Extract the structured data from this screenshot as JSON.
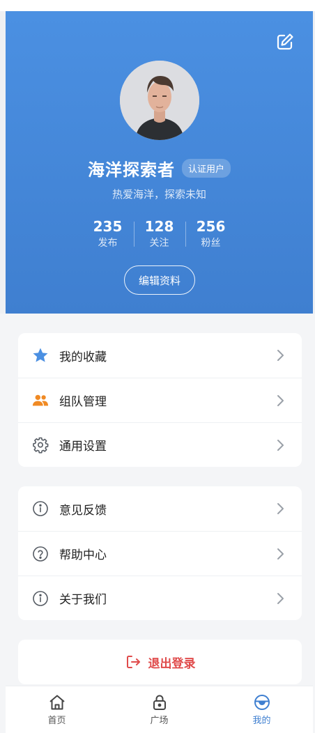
{
  "colors": {
    "accent": "#4b90e2",
    "logout": "#e04b4b",
    "team_icon": "#f08a24"
  },
  "profile": {
    "name": "海洋探索者",
    "badge": "认证用户",
    "bio": "热爱海洋，探索未知",
    "edit_button": "编辑资料",
    "edit_icon": "edit-icon",
    "stats": [
      {
        "value": "235",
        "label": "发布"
      },
      {
        "value": "128",
        "label": "关注"
      },
      {
        "value": "256",
        "label": "粉丝"
      }
    ]
  },
  "menu_group_1": [
    {
      "label": "我的收藏",
      "icon": "star-icon"
    },
    {
      "label": "组队管理",
      "icon": "team-icon"
    },
    {
      "label": "通用设置",
      "icon": "gear-icon"
    }
  ],
  "menu_group_2": [
    {
      "label": "意见反馈",
      "icon": "info-icon"
    },
    {
      "label": "帮助中心",
      "icon": "help-icon"
    },
    {
      "label": "关于我们",
      "icon": "info-icon"
    }
  ],
  "logout": {
    "label": "退出登录",
    "icon": "logout-icon"
  },
  "tabbar": [
    {
      "label": "首页",
      "icon": "home-icon"
    },
    {
      "label": "广场",
      "icon": "lock-icon"
    },
    {
      "label": "我的",
      "icon": "profile-icon",
      "active": true
    }
  ]
}
